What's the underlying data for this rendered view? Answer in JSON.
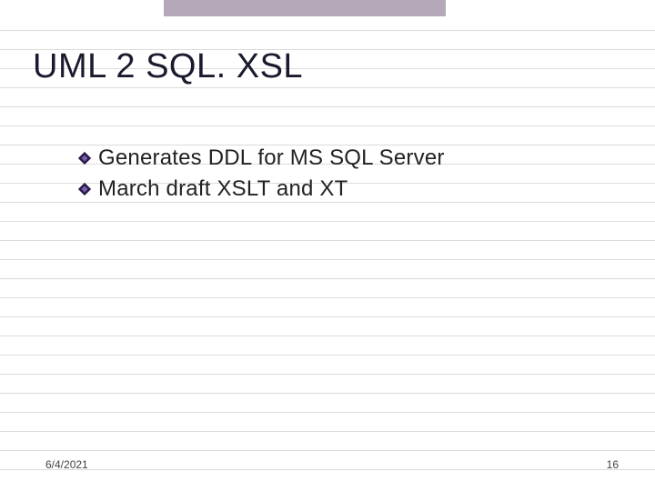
{
  "slide": {
    "title": "UML 2 SQL. XSL",
    "bullets": [
      "Generates DDL for MS SQL Server",
      "March draft XSLT and XT"
    ]
  },
  "footer": {
    "date": "6/4/2021",
    "page": "16"
  }
}
